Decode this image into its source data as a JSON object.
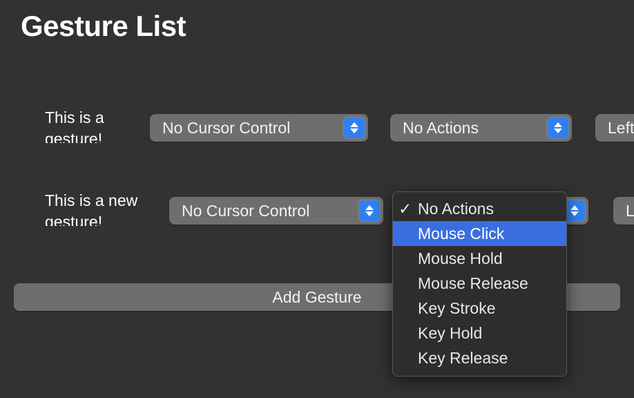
{
  "window": {
    "title": "Gesture List",
    "background_color": "#323232"
  },
  "colors": {
    "accent_blue": "#2f7ff0",
    "menu_highlight": "#3a6ee0",
    "control_fill": "#6e6e6e",
    "menu_fill": "#2d2d2d"
  },
  "rows": [
    {
      "label": "This is a gesture!",
      "cursor_control": "No Cursor Control",
      "action": "No Actions",
      "key": "Left"
    },
    {
      "label": "This is a new gesture!",
      "cursor_control": "No Cursor Control",
      "action": "No Actions",
      "key": "L"
    }
  ],
  "add_button": {
    "label": "Add Gesture"
  },
  "open_menu": {
    "checkmark": "✓",
    "selected_index": 1,
    "checked_index": 0,
    "items": [
      "No Actions",
      "Mouse Click",
      "Mouse Hold",
      "Mouse Release",
      "Key Stroke",
      "Key Hold",
      "Key Release"
    ]
  }
}
